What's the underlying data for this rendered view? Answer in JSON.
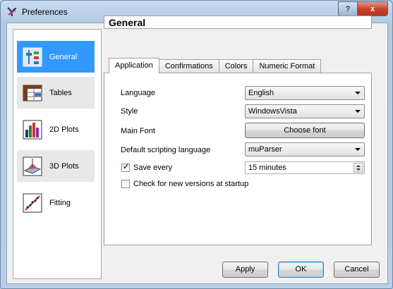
{
  "window": {
    "title": "Preferences"
  },
  "title_buttons": {
    "help": "?",
    "close": "x"
  },
  "sidebar": {
    "items": [
      {
        "label": "General",
        "icon": "general-settings-icon",
        "selected": true
      },
      {
        "label": "Tables",
        "icon": "table-icon",
        "selected": false
      },
      {
        "label": "2D Plots",
        "icon": "bar-chart-icon",
        "selected": false
      },
      {
        "label": "3D Plots",
        "icon": "3d-plot-icon",
        "selected": false
      },
      {
        "label": "Fitting",
        "icon": "fitting-icon",
        "selected": false
      }
    ]
  },
  "panel": {
    "title": "General"
  },
  "tabs": [
    {
      "label": "Application",
      "active": true
    },
    {
      "label": "Confirmations",
      "active": false
    },
    {
      "label": "Colors",
      "active": false
    },
    {
      "label": "Numeric Format",
      "active": false
    }
  ],
  "application": {
    "language_label": "Language",
    "language_value": "English",
    "style_label": "Style",
    "style_value": "WindowsVista",
    "font_label": "Main Font",
    "font_button": "Choose font",
    "scripting_label": "Default scripting language",
    "scripting_value": "muParser",
    "save_label": "Save every",
    "save_checked": true,
    "save_value": "15 minutes",
    "updates_label": "Check for new versions at startup",
    "updates_checked": false
  },
  "buttons": {
    "apply": "Apply",
    "ok": "OK",
    "cancel": "Cancel"
  },
  "colors": {
    "selection": "#3399ff",
    "close_button": "#c9432b"
  }
}
